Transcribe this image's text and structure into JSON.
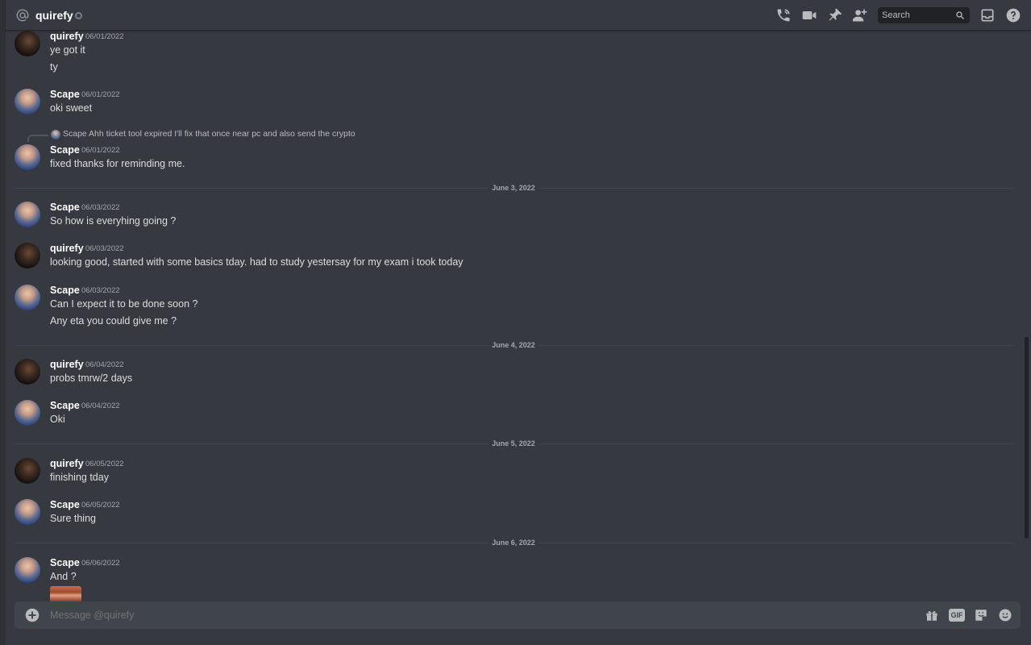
{
  "header": {
    "title": "quirefy",
    "search_placeholder": "Search",
    "icons": [
      "at-icon",
      "voice-call-icon",
      "video-call-icon",
      "pin-icon",
      "add-friend-icon",
      "search-icon",
      "inbox-icon",
      "help-icon"
    ]
  },
  "messages": [
    {
      "author": "quirefy",
      "timestamp": "06/01/2022",
      "lines": [
        "ye got it",
        "ty"
      ]
    },
    {
      "author": "Scape",
      "timestamp": "06/01/2022",
      "lines": [
        "oki sweet"
      ]
    },
    {
      "author": "Scape",
      "timestamp": "06/01/2022",
      "lines": [
        "fixed thanks for reminding me."
      ],
      "reply": {
        "author": "Scape",
        "text": "Ahh ticket tool expired I'll fix that once near pc and also send the crypto"
      }
    },
    {
      "author": "Scape",
      "timestamp": "06/03/2022",
      "lines": [
        "So how is everyhing going ?"
      ]
    },
    {
      "author": "quirefy",
      "timestamp": "06/03/2022",
      "lines": [
        "looking good, started with some basics tday. had to study yestersay for my exam i took today"
      ]
    },
    {
      "author": "Scape",
      "timestamp": "06/03/2022",
      "lines": [
        "Can I expect it to be done soon ?",
        "Any eta you could give me ?"
      ]
    },
    {
      "author": "quirefy",
      "timestamp": "06/04/2022",
      "lines": [
        "probs tmrw/2 days"
      ]
    },
    {
      "author": "Scape",
      "timestamp": "06/04/2022",
      "lines": [
        "Oki"
      ]
    },
    {
      "author": "quirefy",
      "timestamp": "06/05/2022",
      "lines": [
        "finishing tday"
      ]
    },
    {
      "author": "Scape",
      "timestamp": "06/05/2022",
      "lines": [
        "Sure thing"
      ]
    },
    {
      "author": "Scape",
      "timestamp": "06/06/2022",
      "lines": [
        "And ?"
      ]
    }
  ],
  "dividers": [
    "June 3, 2022",
    "June 4, 2022",
    "June 5, 2022",
    "June 6, 2022"
  ],
  "composer": {
    "placeholder": "Message @quirefy",
    "buttons": [
      "gift-icon",
      "gif-icon",
      "sticker-icon",
      "emoji-icon"
    ],
    "gif_label": "GIF"
  },
  "colors": {
    "background": "#36393f",
    "sidebar": "#2f3136",
    "input": "#40444b",
    "text": "#dcddde",
    "muted": "#a3a6aa",
    "status_offline": "#747f8d"
  }
}
